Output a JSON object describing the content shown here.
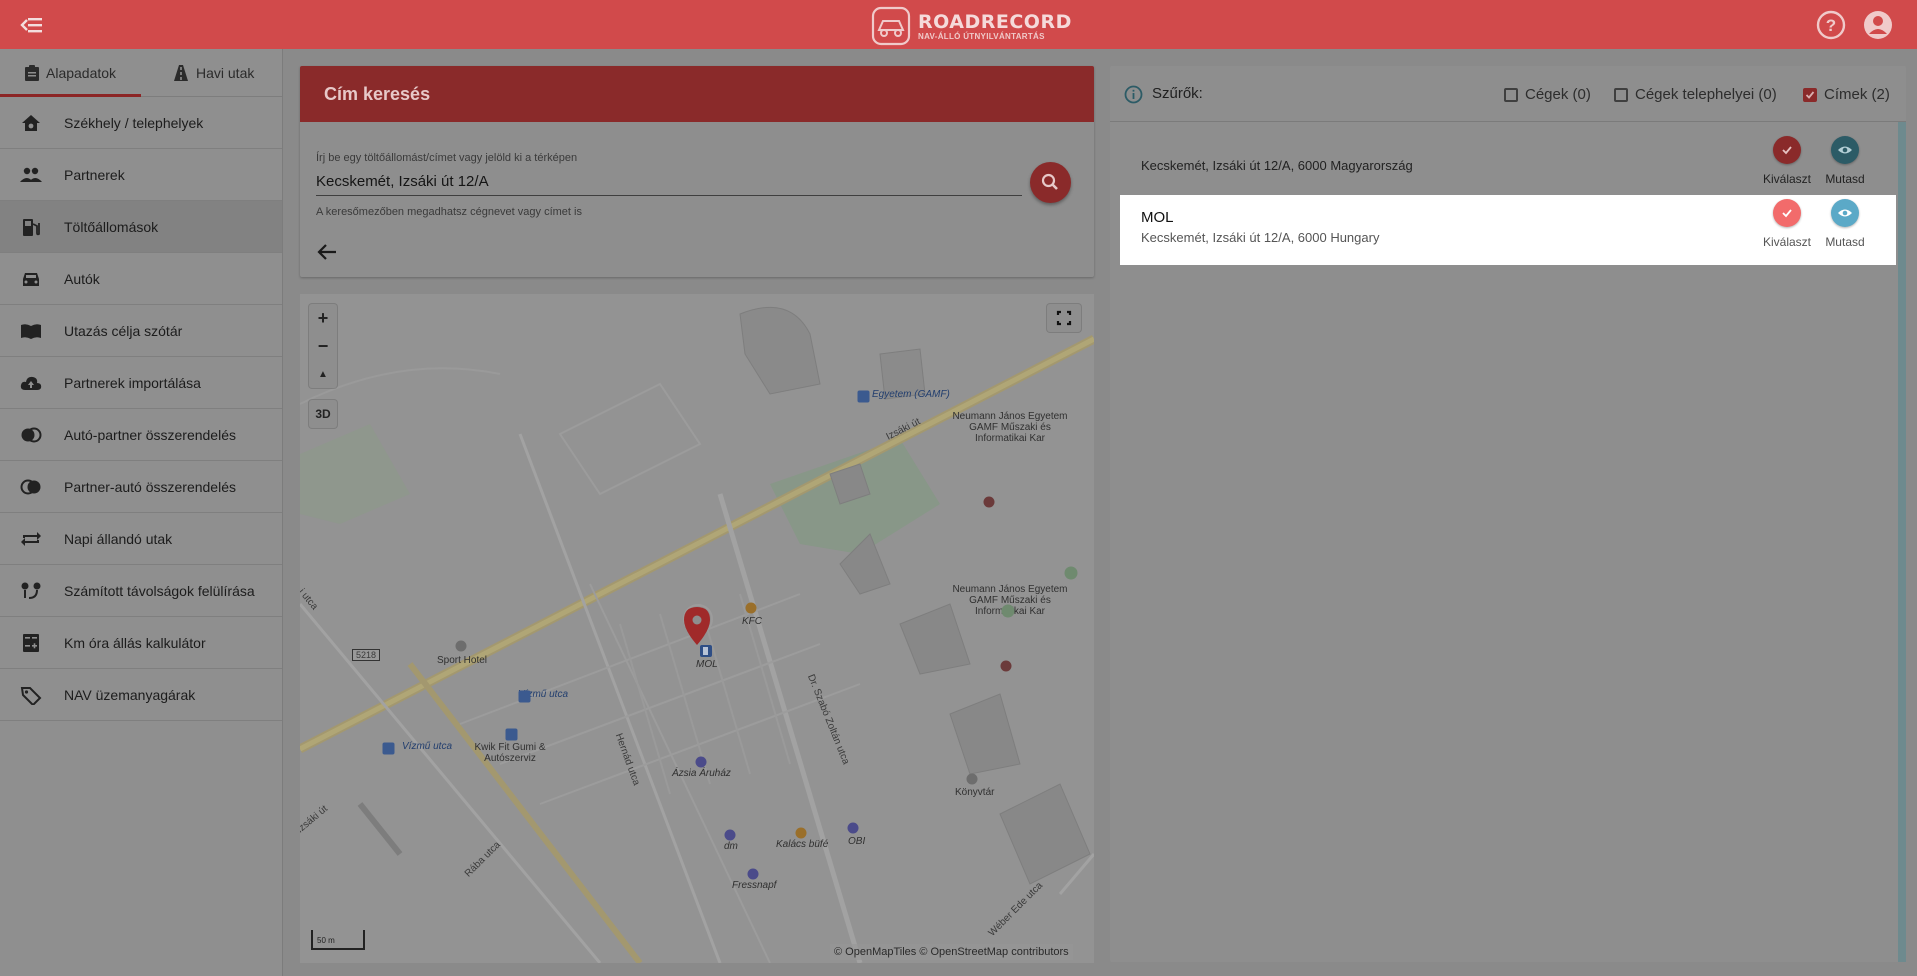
{
  "header": {
    "logo_title": "ROADRECORD",
    "logo_subtitle": "NAV-ÁLLÓ ÚTNYILVÁNTARTÁS"
  },
  "sidebar": {
    "tabs": [
      {
        "label": "Alapadatok",
        "active": true
      },
      {
        "label": "Havi utak",
        "active": false
      }
    ],
    "items": [
      {
        "label": "Székhely / telephelyek",
        "icon": "home-gear-icon"
      },
      {
        "label": "Partnerek",
        "icon": "people-icon"
      },
      {
        "label": "Töltőállomások",
        "icon": "fuel-pump-icon",
        "active": true
      },
      {
        "label": "Autók",
        "icon": "car-icon"
      },
      {
        "label": "Utazás célja szótár",
        "icon": "book-icon"
      },
      {
        "label": "Partnerek importálása",
        "icon": "cloud-upload-icon"
      },
      {
        "label": "Autó-partner összerendelés",
        "icon": "link-icon"
      },
      {
        "label": "Partner-autó összerendelés",
        "icon": "link-icon"
      },
      {
        "label": "Napi állandó utak",
        "icon": "repeat-icon"
      },
      {
        "label": "Számított távolságok felülírása",
        "icon": "route-icon"
      },
      {
        "label": "Km óra állás kalkulátor",
        "icon": "calculator-icon"
      },
      {
        "label": "NAV üzemanyagárak",
        "icon": "price-tag-icon"
      }
    ]
  },
  "search": {
    "title": "Cím keresés",
    "hint": "Írj be egy töltőállomást/címet vagy jelöld ki a térképen",
    "value": "Kecskemét, Izsáki út 12/A",
    "help": "A keresőmezőben megadhatsz cégnevet vagy címet is"
  },
  "map": {
    "zoom_in": "+",
    "zoom_out": "−",
    "compass": "▲",
    "btn_3d": "3D",
    "scale": "50 m",
    "attribution": "© OpenMapTiles © OpenStreetMap contributors",
    "labels": {
      "egyetem_gamf": "Egyetem (GAMF)",
      "izsaki_ut_1": "Izsáki út",
      "izsaki_ut_2": "Izsáki út",
      "neumann_1": "Neumann János Egyetem GAMF Műszaki és Informatikai Kar",
      "neumann_2": "Neumann János Egyetem GAMF Műszaki és Informatikai Kar",
      "kfc": "KFC",
      "mol": "MOL",
      "sport_hotel": "Sport Hotel",
      "road_5218": "5218",
      "vizmu_utca_1": "Vízmű utca",
      "vizmu_utca_2": "Vízmű utca",
      "kwik_fit": "Kwik Fit Gumi & Autószerviz",
      "hernad_utca": "Hernád utca",
      "azsia_aruhaz": "Ázsia Áruház",
      "szabo_zoltan": "Dr. Szabó Zoltán utca",
      "konyvtar": "Könyvtár",
      "obi": "OBI",
      "dm": "dm",
      "kalacs_bufe": "Kalács büfé",
      "fressnapf": "Fressnapf",
      "raba_utca": "Rába utca",
      "weber_ede": "Wéber Ede utca",
      "utca_left": "i utca"
    }
  },
  "filters": {
    "title": "Szűrők:",
    "options": [
      {
        "label": "Cégek (0)",
        "checked": false
      },
      {
        "label": "Cégek telephelyei (0)",
        "checked": false
      },
      {
        "label": "Címek (2)",
        "checked": true
      }
    ]
  },
  "results": [
    {
      "name": "",
      "address": "Kecskemét, Izsáki út 12/A, 6000 Magyarország",
      "select_label": "Kiválaszt",
      "show_label": "Mutasd"
    },
    {
      "name": "MOL",
      "address": "Kecskemét, Izsáki út 12/A, 6000 Hungary",
      "select_label": "Kiválaszt",
      "show_label": "Mutasd"
    }
  ],
  "colors": {
    "brand_red": "#d14a4b",
    "overlay": "#8e8e8e",
    "select_red": "#f26b6b",
    "show_blue": "#5ba9c7"
  }
}
